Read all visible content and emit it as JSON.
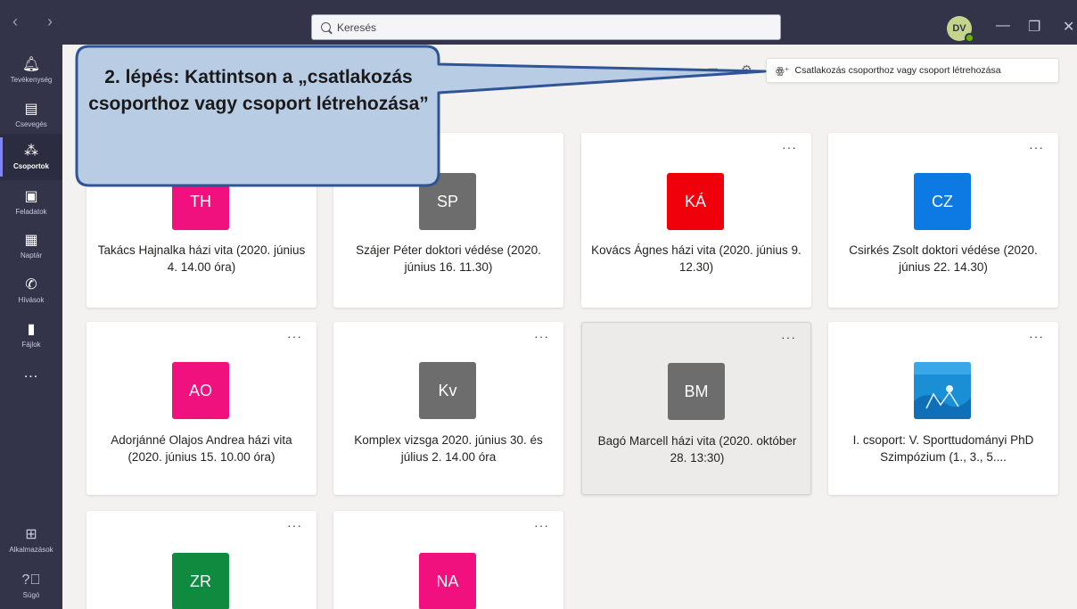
{
  "titlebar": {
    "search_placeholder": "Keresés",
    "avatar_initials": "DV",
    "nav_arrows": "‹ ›"
  },
  "rail": {
    "items": [
      {
        "label": "Tevékenység",
        "icon": "bell-icon"
      },
      {
        "label": "Csevegés",
        "icon": "chat-icon"
      },
      {
        "label": "Csoportok",
        "icon": "teams-icon",
        "active": true
      },
      {
        "label": "Feladatok",
        "icon": "assignments-icon"
      },
      {
        "label": "Naptár",
        "icon": "calendar-icon"
      },
      {
        "label": "Hívások",
        "icon": "phone-icon"
      },
      {
        "label": "Fájlok",
        "icon": "file-icon"
      }
    ],
    "more": "...",
    "apps_label": "Alkalmazások",
    "help_label": "Súgó"
  },
  "header": {
    "join_button": "Csatlakozás csoporthoz vagy csoport létrehozása"
  },
  "callout": {
    "text": "2. lépés: Kattintson a „csatlakozás csoporthoz vagy csoport létrehozása”"
  },
  "teams": [
    {
      "initials": "TH",
      "name": "Takács Hajnalka házi vita (2020. június 4. 14.00 óra)",
      "color": "#f0117e"
    },
    {
      "initials": "SP",
      "name": "Szájer Péter doktori védése (2020. június 16. 11.30)",
      "color": "#6d6d6d"
    },
    {
      "initials": "KÁ",
      "name": "Kovács Ágnes házi vita (2020. június 9. 12.30)",
      "color": "#f0000a"
    },
    {
      "initials": "CZ",
      "name": "Csirkés Zsolt doktori védése (2020. június 22. 14.30)",
      "color": "#0d7ae3"
    },
    {
      "initials": "AO",
      "name": "Adorjánné Olajos Andrea házi vita (2020. június 15. 10.00 óra)",
      "color": "#f0117e"
    },
    {
      "initials": "Kv",
      "name": "Komplex vizsga 2020. június 30. és július 2. 14.00 óra",
      "color": "#6d6d6d"
    },
    {
      "initials": "BM",
      "name": "Bagó Marcell házi vita (2020. október 28. 13:30)",
      "color": "#6d6d6d"
    },
    {
      "initials": "",
      "name": "I. csoport: V. Sporttudományi PhD Szimpózium (1., 3., 5....",
      "color": "#1a8fd6"
    },
    {
      "initials": "ZR",
      "name": "",
      "color": "#108a3e"
    },
    {
      "initials": "NA",
      "name": "",
      "color": "#f0117e"
    }
  ],
  "card_more": "···"
}
